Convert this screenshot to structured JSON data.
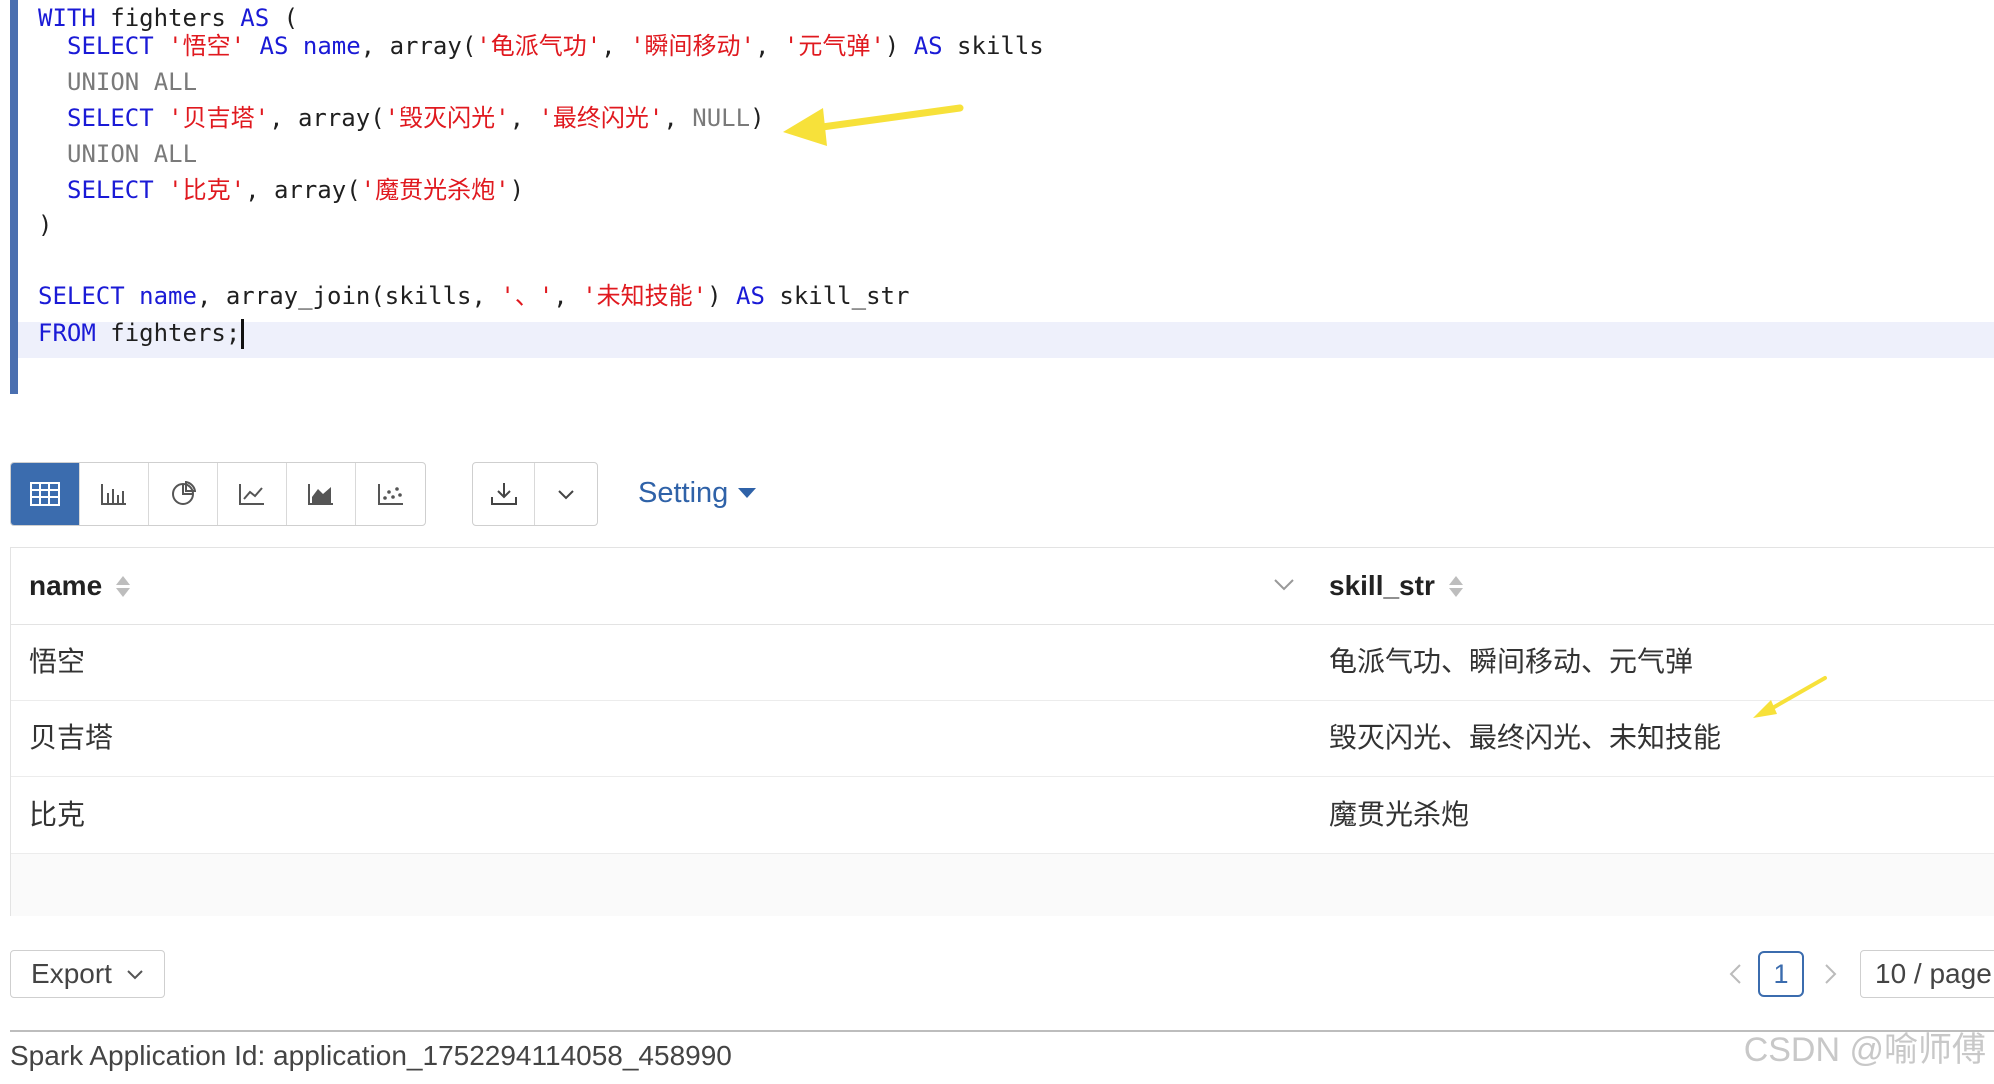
{
  "editor": {
    "lines": {
      "l1": {
        "kw1": "WITH",
        "txt1": " fighters ",
        "kw2": "AS",
        "txt2": " ("
      },
      "l2": {
        "kw1": "SELECT",
        "str1": "'悟空'",
        "kw2": "AS",
        "kw3": "name",
        "txt1": ", array(",
        "str2": "'龟派气功'",
        "sep1": ", ",
        "str3": "'瞬间移动'",
        "sep2": ", ",
        "str4": "'元气弹'",
        "txt2": ") ",
        "kw4": "AS",
        "txt3": " skills"
      },
      "l3": {
        "gray": "UNION ALL"
      },
      "l4": {
        "kw1": "SELECT",
        "str1": "'贝吉塔'",
        "txt1": ", array(",
        "str2": "'毁灭闪光'",
        "sep1": ", ",
        "str3": "'最终闪光'",
        "sep2": ", ",
        "gray": "NULL",
        "txt2": ")"
      },
      "l5": {
        "gray": "UNION ALL"
      },
      "l6": {
        "kw1": "SELECT",
        "str1": "'比克'",
        "txt1": ", array(",
        "str2": "'魔贯光杀炮'",
        "txt2": ")"
      },
      "l7": {
        "txt": ")"
      },
      "l9": {
        "kw1": "SELECT",
        "kw2": "name",
        "txt1": ", array_join(skills, ",
        "str1": "'、'",
        "sep1": ", ",
        "str2": "'未知技能'",
        "txt2": ") ",
        "kw3": "AS",
        "txt3": " skill_str"
      },
      "l10": {
        "kw1": "FROM",
        "txt1": " fighters;"
      }
    }
  },
  "toolbar": {
    "viz_icons": [
      "table-icon",
      "bar-chart-icon",
      "pie-chart-icon",
      "line-chart-icon",
      "area-chart-icon",
      "scatter-chart-icon"
    ],
    "active_view": "table",
    "setting_label": "Setting",
    "accent_color": "#3b6cae",
    "link_color": "#2f62a8"
  },
  "table": {
    "columns": [
      "name",
      "skill_str"
    ],
    "rows": [
      {
        "name": "悟空",
        "skill_str": "龟派气功、瞬间移动、元气弹"
      },
      {
        "name": "贝吉塔",
        "skill_str": "毁灭闪光、最终闪光、未知技能"
      },
      {
        "name": "比克",
        "skill_str": "魔贯光杀炮"
      }
    ]
  },
  "footer": {
    "export_label": "Export",
    "current_page": "1",
    "page_size_label": "10 / page",
    "app_id_text": "Spark Application Id: application_1752294114058_458990",
    "watermark": "CSDN @喻师傅"
  },
  "annotation_color": "#f7e13a"
}
